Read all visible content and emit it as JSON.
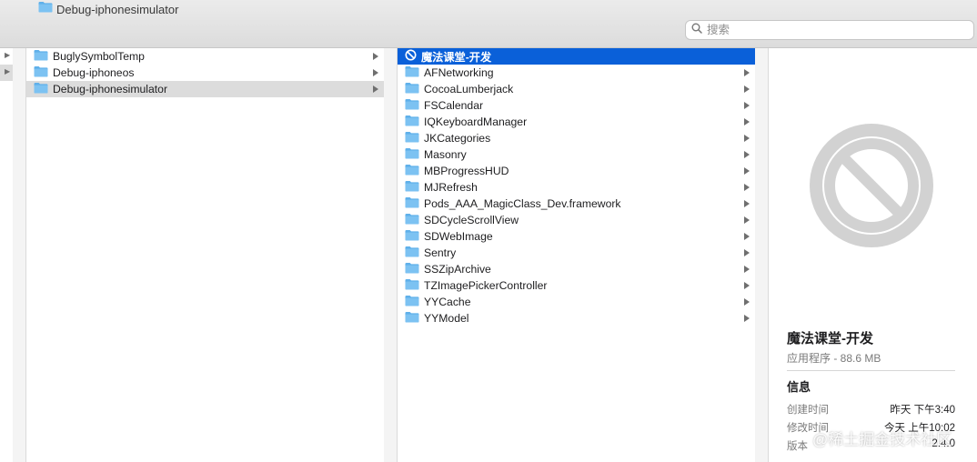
{
  "window": {
    "title": "Debug-iphonesimulator"
  },
  "search": {
    "placeholder": "搜索"
  },
  "column_gutter": {
    "rows": 2,
    "selected_index": 1
  },
  "column1": {
    "items": [
      {
        "label": "BuglySymbolTemp"
      },
      {
        "label": "Debug-iphoneos"
      },
      {
        "label": "Debug-iphonesimulator"
      }
    ],
    "selected_index": 2
  },
  "column2": {
    "selected": {
      "label": "魔法课堂-开发"
    },
    "items": [
      {
        "label": "AFNetworking"
      },
      {
        "label": "CocoaLumberjack"
      },
      {
        "label": "FSCalendar"
      },
      {
        "label": "IQKeyboardManager"
      },
      {
        "label": "JKCategories"
      },
      {
        "label": "Masonry"
      },
      {
        "label": "MBProgressHUD"
      },
      {
        "label": "MJRefresh"
      },
      {
        "label": "Pods_AAA_MagicClass_Dev.framework"
      },
      {
        "label": "SDCycleScrollView"
      },
      {
        "label": "SDWebImage"
      },
      {
        "label": "Sentry"
      },
      {
        "label": "SSZipArchive"
      },
      {
        "label": "TZImagePickerController"
      },
      {
        "label": "YYCache"
      },
      {
        "label": "YYModel"
      }
    ]
  },
  "preview": {
    "name": "魔法课堂-开发",
    "kind_size": "应用程序 - 88.6 MB",
    "info_heading": "信息",
    "rows": [
      {
        "key": "创建时间",
        "value": "昨天 下午3:40"
      },
      {
        "key": "修改时间",
        "value": "今天 上午10:02"
      },
      {
        "key": "版本",
        "value": "2.4.0"
      }
    ]
  },
  "watermark": "@稀土掘金技术社区",
  "colors": {
    "selection_blue": "#0a60d9",
    "selection_grey": "#dcdcdc",
    "folder_blue": "#6ab7ee"
  }
}
